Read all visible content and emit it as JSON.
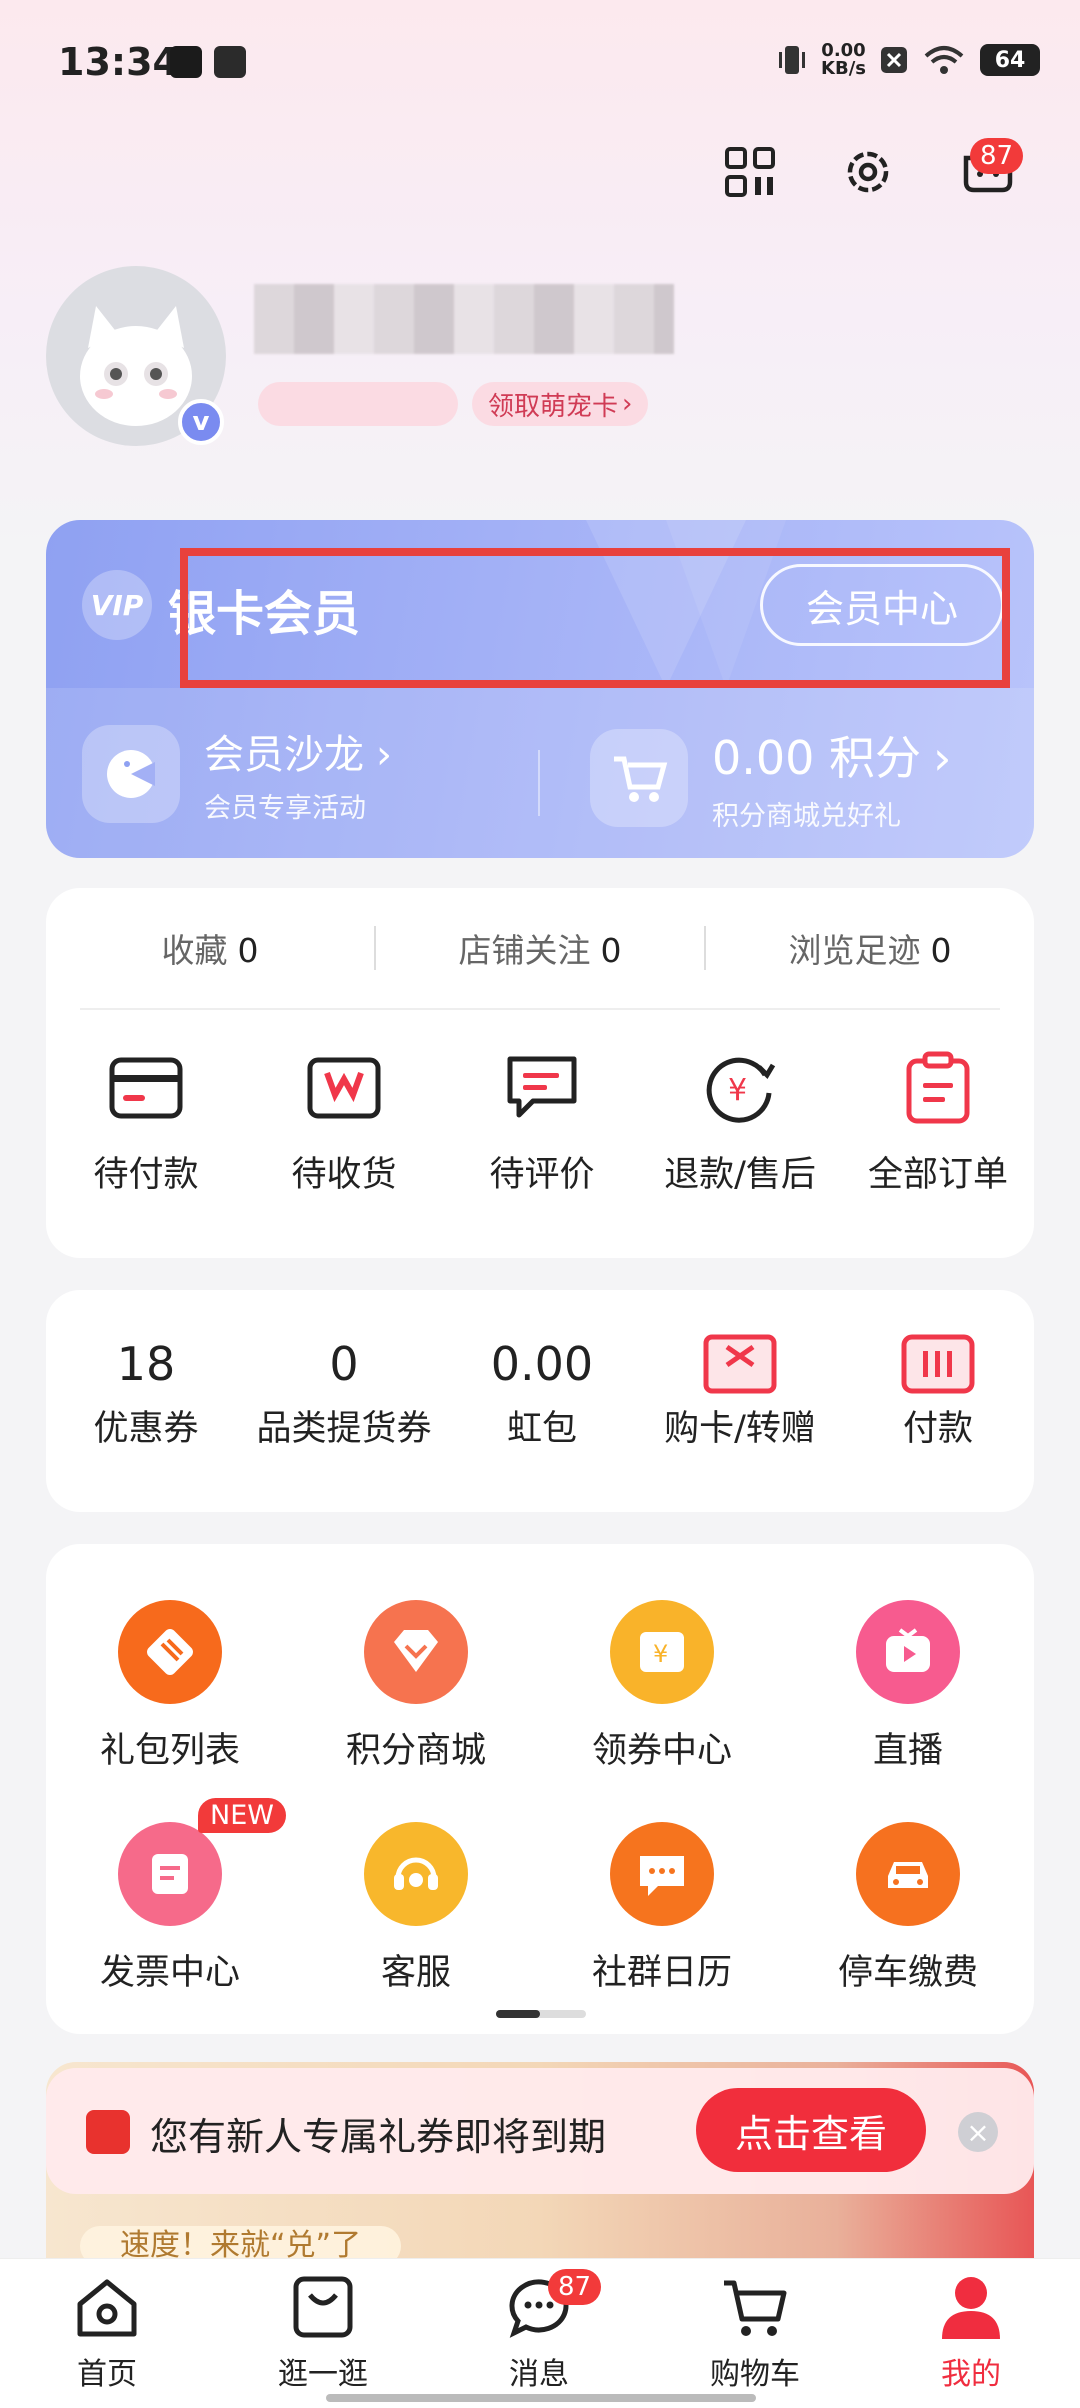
{
  "status_bar": {
    "time": "13:34",
    "net_speed": "0.00",
    "net_unit": "KB/s",
    "battery": "64"
  },
  "header": {
    "cart_badge": "87"
  },
  "profile": {
    "pill_1": "领取",
    "pill_2": "领取萌宠卡"
  },
  "vip": {
    "title": "银卡会员",
    "center_button": "会员中心",
    "salon_title": "会员沙龙",
    "salon_desc": "会员专享活动",
    "points_title": "0.00 积分",
    "points_desc": "积分商城兑好礼"
  },
  "stats": [
    {
      "label": "收藏",
      "value": "0"
    },
    {
      "label": "店铺关注",
      "value": "0"
    },
    {
      "label": "浏览足迹",
      "value": "0"
    }
  ],
  "orders": [
    "待付款",
    "待收货",
    "待评价",
    "退款/售后",
    "全部订单"
  ],
  "wallet": [
    {
      "value": "18",
      "label": "优惠券"
    },
    {
      "value": "0",
      "label": "品类提货券"
    },
    {
      "value": "0.00",
      "label": "虹包"
    },
    {
      "icon": "card-icon",
      "label": "购卡/转赠"
    },
    {
      "icon": "pay-icon",
      "label": "付款"
    }
  ],
  "services": [
    {
      "label": "礼包列表",
      "color": "#f76a1c",
      "icon": "gift-tag-icon"
    },
    {
      "label": "积分商城",
      "color": "#f6734f",
      "icon": "diamond-icon"
    },
    {
      "label": "领券中心",
      "color": "#f9b32a",
      "icon": "coupon-icon"
    },
    {
      "label": "直播",
      "color": "#f75b8f",
      "icon": "tv-icon"
    },
    {
      "label": "发票中心",
      "color": "#f66a8a",
      "icon": "invoice-icon"
    },
    {
      "label": "客服",
      "color": "#f8b72c",
      "icon": "headset-icon"
    },
    {
      "label": "社群日历",
      "color": "#f6741e",
      "icon": "chat-icon"
    },
    {
      "label": "停车缴费",
      "color": "#f6711f",
      "icon": "car-icon"
    }
  ],
  "new_badge": "NEW",
  "promo": {
    "text": "您有新人专属礼券即将到期",
    "button": "点击查看",
    "sub": "速度！来就“兑”了"
  },
  "nav": [
    {
      "label": "首页",
      "icon": "home-icon"
    },
    {
      "label": "逛一逛",
      "icon": "bag-icon"
    },
    {
      "label": "消息",
      "icon": "message-icon",
      "badge": "87"
    },
    {
      "label": "购物车",
      "icon": "cart-icon"
    },
    {
      "label": "我的",
      "icon": "profile-icon",
      "active": true
    }
  ],
  "colors": {
    "accent": "#f02d3f",
    "vip_gradient_start": "#8fa1f2",
    "highlight": "#e8413d"
  }
}
